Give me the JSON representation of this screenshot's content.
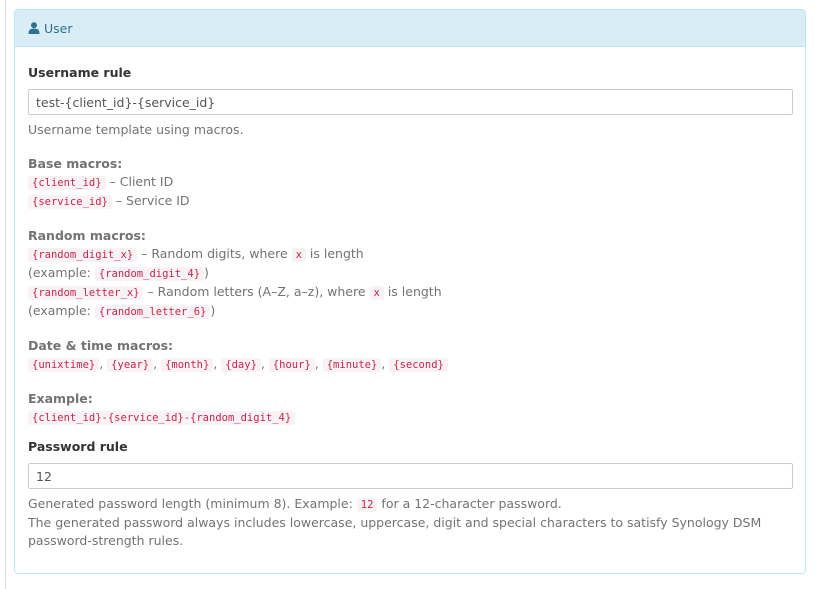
{
  "panel": {
    "title": "User",
    "icon": "user-icon"
  },
  "username": {
    "label": "Username rule",
    "value": "test-{client_id}-{service_id}",
    "help": "Username template using macros."
  },
  "base_macros": {
    "title": "Base macros:",
    "items": [
      {
        "code": "{client_id}",
        "desc": " – Client ID"
      },
      {
        "code": "{service_id}",
        "desc": " – Service ID"
      }
    ]
  },
  "random_macros": {
    "title": "Random macros:",
    "digit": {
      "code": "{random_digit_x}",
      "text1": " – Random digits, where ",
      "x": "x",
      "text2": " is length"
    },
    "digit_example": {
      "pre": "(example: ",
      "code": "{random_digit_4}",
      "post": ")"
    },
    "letter": {
      "code": "{random_letter_x}",
      "text1": " – Random letters (A–Z, a–z), where ",
      "x": "x",
      "text2": " is length"
    },
    "letter_example": {
      "pre": "(example: ",
      "code": "{random_letter_6}",
      "post": ")"
    }
  },
  "datetime_macros": {
    "title": "Date & time macros:",
    "codes": [
      "{unixtime}",
      "{year}",
      "{month}",
      "{day}",
      "{hour}",
      "{minute}",
      "{second}"
    ],
    "sep": ", "
  },
  "example": {
    "title": "Example:",
    "code": "{client_id}-{service_id}-{random_digit_4}"
  },
  "password": {
    "label": "Password rule",
    "value": "12",
    "help1_pre": "Generated password length (minimum 8). Example: ",
    "help1_code": "12",
    "help1_post": " for a 12-character password.",
    "help2": "The generated password always includes lowercase, uppercase, digit and special characters to satisfy Synology DSM password-strength rules."
  },
  "colors": {
    "heading_bg": "#d9edf7",
    "heading_text": "#31708f",
    "code_text": "#c7254e",
    "code_bg": "#f9f2f4"
  }
}
